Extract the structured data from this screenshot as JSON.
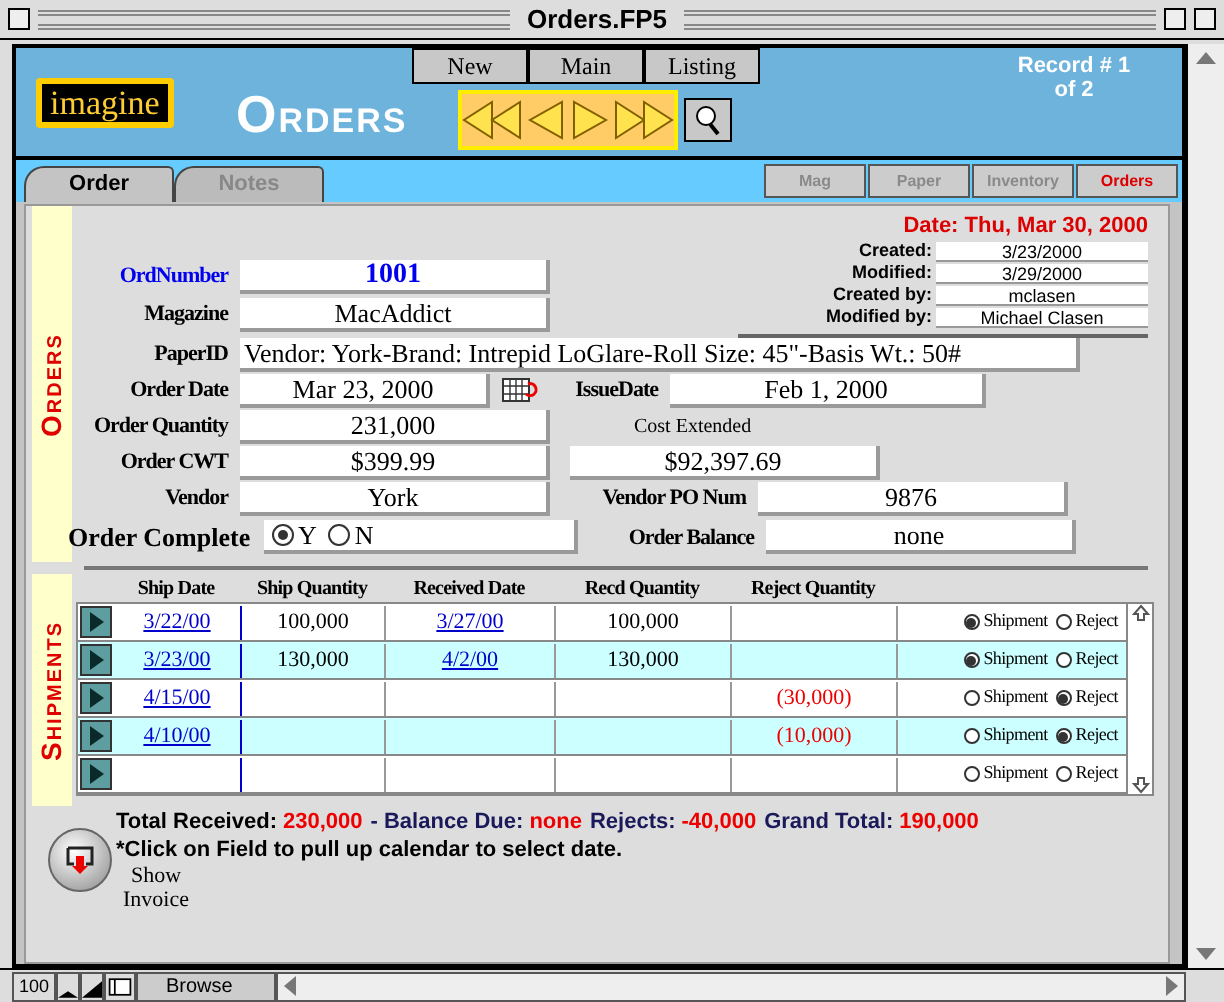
{
  "window": {
    "title": "Orders.FP5"
  },
  "header": {
    "logo": "imagine",
    "title": "ORDERS",
    "nav_buttons": [
      "New",
      "Main",
      "Listing"
    ],
    "record_line_1": "Record # 1",
    "record_line_2": "of 2"
  },
  "tabs": [
    {
      "label": "Order",
      "selected": true
    },
    {
      "label": "Notes",
      "selected": false
    }
  ],
  "module_buttons": [
    {
      "label": "Mag",
      "selected": false
    },
    {
      "label": "Paper",
      "selected": false
    },
    {
      "label": "Inventory",
      "selected": false
    },
    {
      "label": "Orders",
      "selected": true
    }
  ],
  "orders": {
    "section_label": "ORDERS",
    "date_line": "Date: Thu, Mar 30, 2000",
    "meta": [
      {
        "label": "Created:",
        "value": "3/23/2000"
      },
      {
        "label": "Modified:",
        "value": "3/29/2000"
      },
      {
        "label": "Created by:",
        "value": "mclasen"
      },
      {
        "label": "Modified by:",
        "value": "Michael Clasen"
      }
    ],
    "order_number": {
      "label": "OrdNumber",
      "value": "1001"
    },
    "magazine": {
      "label": "Magazine",
      "value": "MacAddict"
    },
    "paper_id": {
      "label": "PaperID",
      "value": "Vendor: York-Brand: Intrepid LoGlare-Roll Size: 45\"-Basis Wt.: 50#"
    },
    "order_date": {
      "label": "Order Date",
      "value": "Mar 23, 2000"
    },
    "issue_date": {
      "label": "IssueDate",
      "value": "Feb 1, 2000"
    },
    "order_quantity": {
      "label": "Order Quantity",
      "value": "231,000"
    },
    "cost_extended": {
      "label": "Cost Extended",
      "value": "$92,397.69"
    },
    "order_cwt": {
      "label": "Order CWT",
      "value": "$399.99"
    },
    "vendor": {
      "label": "Vendor",
      "value": "York"
    },
    "vendor_po_num": {
      "label": "Vendor PO Num",
      "value": "9876"
    },
    "order_complete": {
      "label": "Order Complete",
      "options": [
        {
          "label": "Y",
          "selected": true
        },
        {
          "label": "N",
          "selected": false
        }
      ]
    },
    "order_balance": {
      "label": "Order Balance",
      "value": "none"
    }
  },
  "shipments": {
    "section_label": "SHIPMENTS",
    "columns": [
      "Ship Date",
      "Ship Quantity",
      "Received Date",
      "Recd Quantity",
      "Reject Quantity"
    ],
    "rows": [
      {
        "ship_date": "3/22/00",
        "ship_quantity": "100,000",
        "received_date": "3/27/00",
        "recd_quantity": "100,000",
        "reject_quantity": "",
        "options": [
          {
            "label": "Shipment",
            "selected": true
          },
          {
            "label": "Reject",
            "selected": false
          }
        ]
      },
      {
        "ship_date": "3/23/00",
        "ship_quantity": "130,000",
        "received_date": "4/2/00",
        "recd_quantity": "130,000",
        "reject_quantity": "",
        "options": [
          {
            "label": "Shipment",
            "selected": true
          },
          {
            "label": "Reject",
            "selected": false
          }
        ]
      },
      {
        "ship_date": "4/15/00",
        "ship_quantity": "",
        "received_date": "",
        "recd_quantity": "",
        "reject_quantity": "(30,000)",
        "options": [
          {
            "label": "Shipment",
            "selected": false
          },
          {
            "label": "Reject",
            "selected": true
          }
        ]
      },
      {
        "ship_date": "4/10/00",
        "ship_quantity": "",
        "received_date": "",
        "recd_quantity": "",
        "reject_quantity": "(10,000)",
        "options": [
          {
            "label": "Shipment",
            "selected": false
          },
          {
            "label": "Reject",
            "selected": true
          }
        ]
      },
      {
        "ship_date": "",
        "ship_quantity": "",
        "received_date": "",
        "recd_quantity": "",
        "reject_quantity": "",
        "options": [
          {
            "label": "Shipment",
            "selected": false
          },
          {
            "label": "Reject",
            "selected": false
          }
        ]
      }
    ]
  },
  "totals": [
    {
      "label": "Total Received:",
      "value": "230,000"
    },
    {
      "label": "- Balance Due:",
      "value": "none"
    },
    {
      "label": "Rejects:",
      "value": "-40,000"
    },
    {
      "label": "Grand Total:",
      "value": "190,000"
    }
  ],
  "note": "*Click on Field to pull up calendar to select date.",
  "show_invoice": {
    "line_1": "Show",
    "line_2": "Invoice"
  },
  "status_bar": {
    "zoom": "100",
    "mode": "Browse"
  }
}
